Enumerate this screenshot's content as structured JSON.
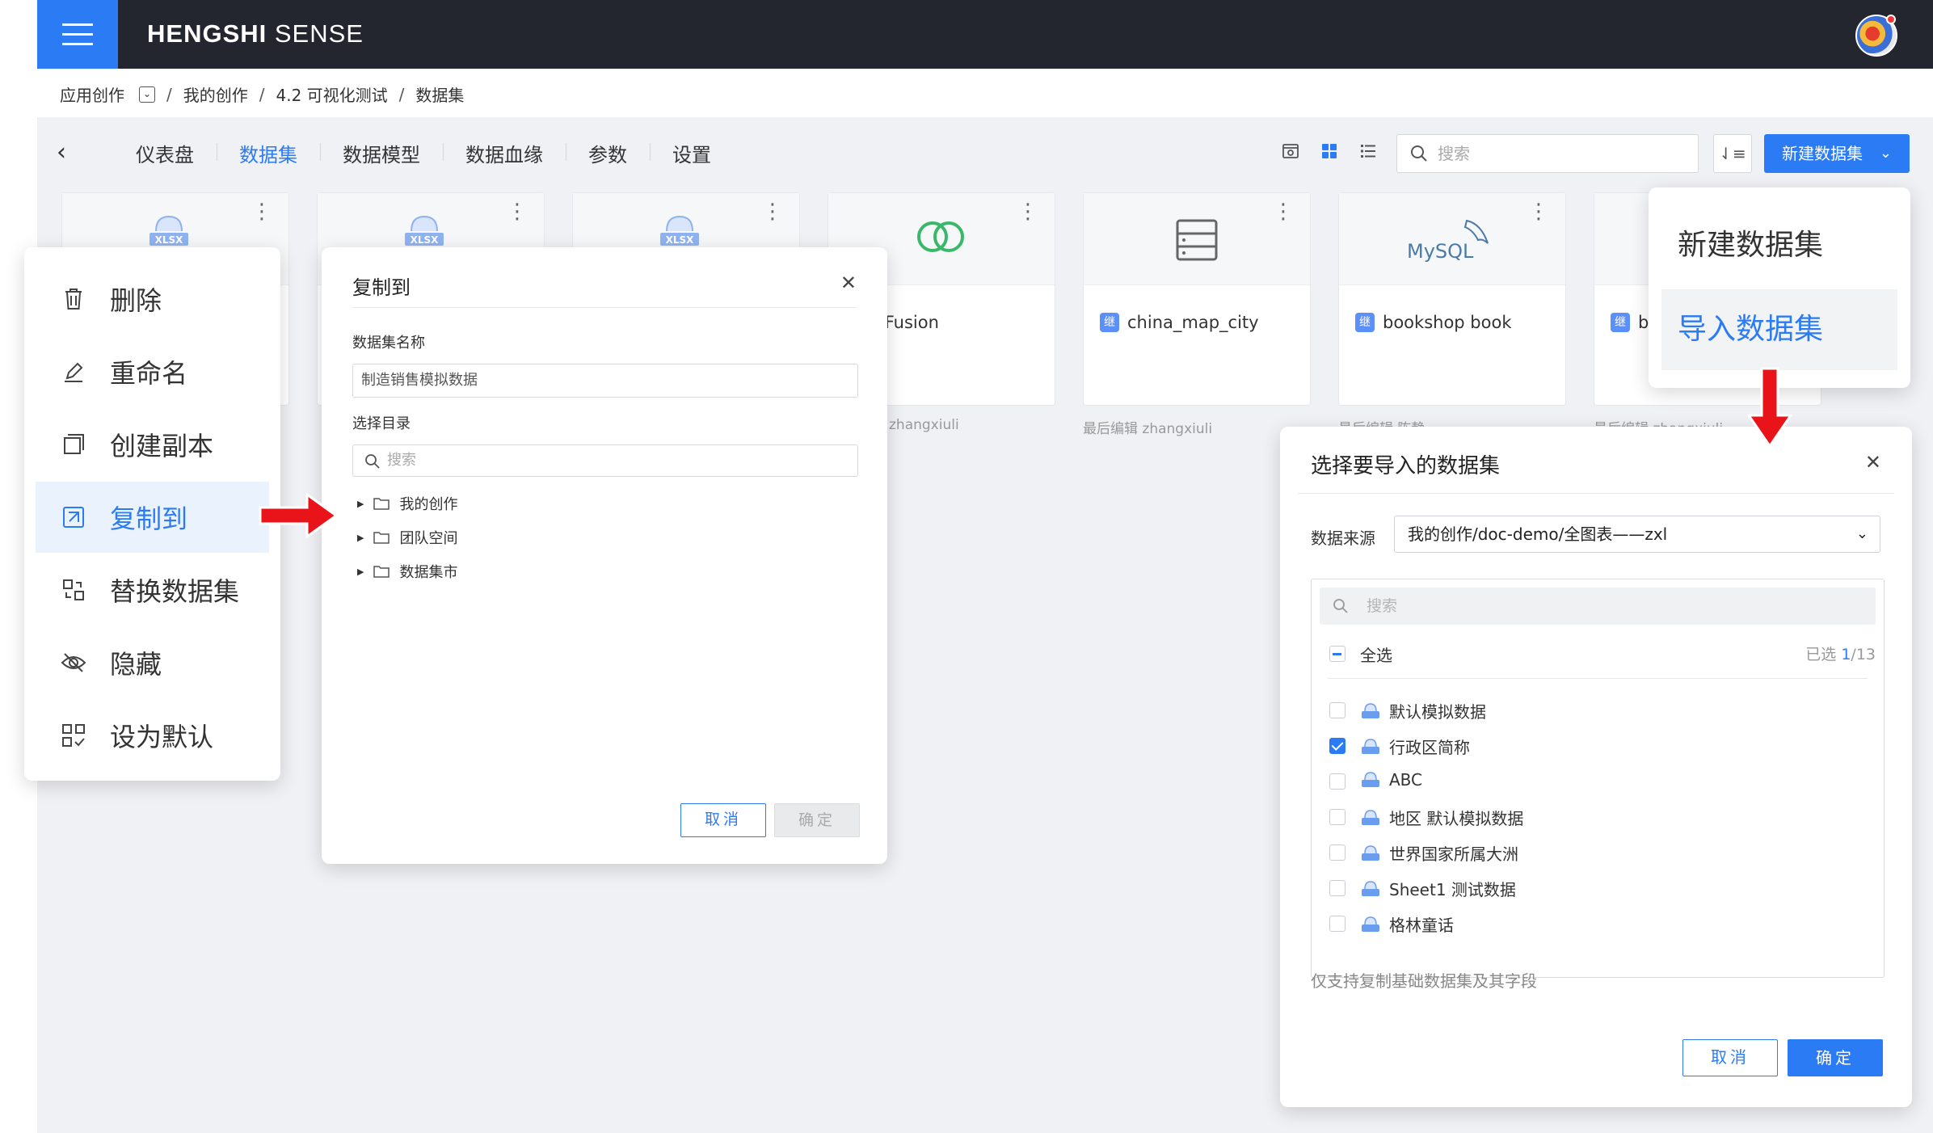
{
  "app": {
    "brand_bold": "HENGSHI",
    "brand_rest": " SENSE"
  },
  "breadcrumb": {
    "items": [
      "应用创作",
      "我的创作",
      "4.2 可视化测试",
      "数据集"
    ],
    "separator": "/"
  },
  "tabs": [
    {
      "label": "仪表盘",
      "active": false
    },
    {
      "label": "数据集",
      "active": true
    },
    {
      "label": "数据模型",
      "active": false
    },
    {
      "label": "数据血缘",
      "active": false
    },
    {
      "label": "参数",
      "active": false
    },
    {
      "label": "设置",
      "active": false
    }
  ],
  "toolbar": {
    "search_placeholder": "搜索",
    "new_button": "新建数据集"
  },
  "cards": [
    {
      "thumb": "xlsx",
      "name": "",
      "meta": ""
    },
    {
      "thumb": "xlsx",
      "name": "",
      "meta": ""
    },
    {
      "thumb": "xlsx",
      "name": "",
      "meta": ""
    },
    {
      "thumb": "fusion",
      "name": "sets Fusion",
      "meta": "zhangxiuli"
    },
    {
      "thumb": "table",
      "name": "china_map_city",
      "meta": "最后编辑 zhangxiuli"
    },
    {
      "thumb": "mysql",
      "name": "bookshop book",
      "meta": "最后编辑 陈静"
    },
    {
      "thumb": "blank",
      "name": "b",
      "meta": "最后编辑 zhangxiuli"
    }
  ],
  "inherit_badge": "继",
  "mysql_logo": "MySQL",
  "xlsx_label": "XLSX",
  "context_menu": [
    {
      "label": "删除",
      "icon": "trash-icon"
    },
    {
      "label": "重命名",
      "icon": "pencil-icon"
    },
    {
      "label": "创建副本",
      "icon": "copy-icon"
    },
    {
      "label": "复制到",
      "icon": "copy-to-icon",
      "active": true
    },
    {
      "label": "替换数据集",
      "icon": "swap-icon"
    },
    {
      "label": "隐藏",
      "icon": "eye-off-icon"
    },
    {
      "label": "设为默认",
      "icon": "grid-check-icon"
    }
  ],
  "copy_dialog": {
    "title": "复制到",
    "name_label": "数据集名称",
    "name_value": "制造销售模拟数据",
    "dir_label": "选择目录",
    "dir_search_placeholder": "搜索",
    "tree": [
      "我的创作",
      "团队空间",
      "数据集市"
    ],
    "cancel": "取消",
    "ok": "确定"
  },
  "new_menu": {
    "items": [
      "新建数据集",
      "导入数据集"
    ],
    "selected": 1
  },
  "import_dialog": {
    "title": "选择要导入的数据集",
    "source_label": "数据来源",
    "source_value": "我的创作/doc-demo/全图表——zxl",
    "search_placeholder": "搜索",
    "select_all": "全选",
    "selected_prefix": "已选 ",
    "selected_num": "1",
    "selected_total": "/13",
    "items": [
      {
        "label": "默认模拟数据",
        "checked": false
      },
      {
        "label": "行政区简称",
        "checked": true
      },
      {
        "label": "ABC",
        "checked": false
      },
      {
        "label": "地区 默认模拟数据",
        "checked": false
      },
      {
        "label": "世界国家所属大洲",
        "checked": false
      },
      {
        "label": "Sheet1 测试数据",
        "checked": false
      },
      {
        "label": "格林童话",
        "checked": false
      }
    ],
    "hint": "仅支持复制基础数据集及其字段",
    "cancel": "取消",
    "ok": "确定"
  },
  "colors": {
    "primary": "#2b7bf5",
    "topbar": "#23252f",
    "arrow": "#e8141a"
  }
}
